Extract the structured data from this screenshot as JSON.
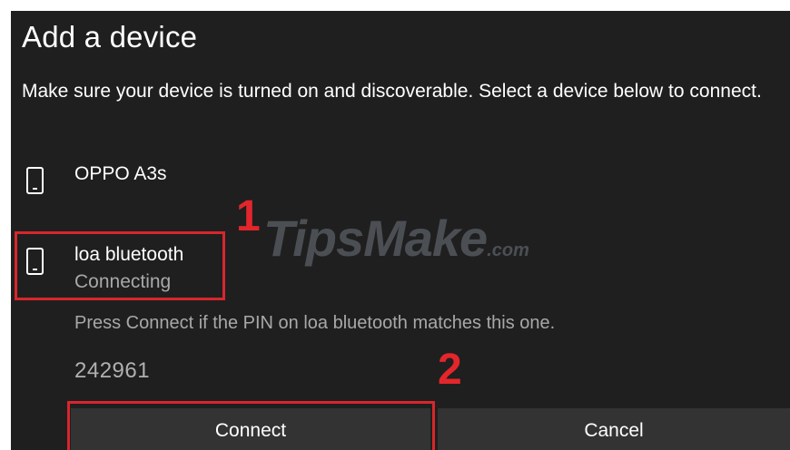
{
  "dialog": {
    "title": "Add a device",
    "instructions": "Make sure your device is turned on and discoverable. Select a device below to connect."
  },
  "devices": [
    {
      "name": "OPPO A3s",
      "icon": "phone-icon"
    },
    {
      "name": "loa bluetooth",
      "status": "Connecting",
      "icon": "phone-icon"
    }
  ],
  "pairing": {
    "prompt": "Press Connect if the PIN on loa bluetooth matches this one.",
    "pin": "242961"
  },
  "buttons": {
    "connect": "Connect",
    "cancel": "Cancel"
  },
  "annotations": {
    "step1": "1",
    "step2": "2",
    "highlight_color": "#d8262c"
  },
  "watermark": {
    "main": "TipsMake",
    "suffix": ".com"
  },
  "colors": {
    "background": "#1f1f1f",
    "text": "#ffffff",
    "secondary_text": "#a8a8a8",
    "button": "#333333"
  }
}
